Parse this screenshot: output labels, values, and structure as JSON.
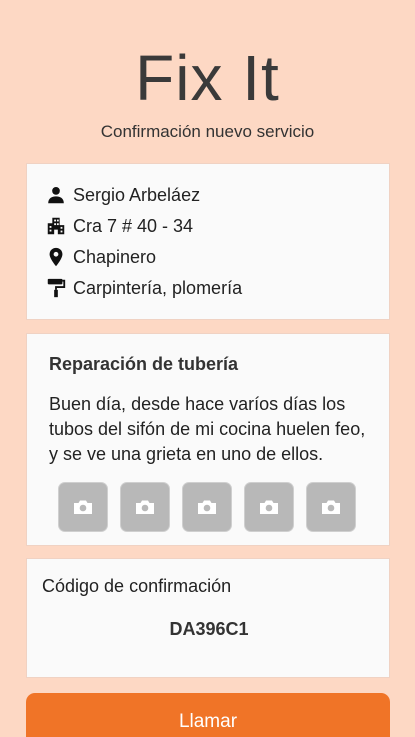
{
  "app": {
    "title": "Fix It",
    "subtitle": "Confirmación nuevo servicio"
  },
  "client": {
    "name": "Sergio Arbeláez",
    "address": "Cra 7 # 40 - 34",
    "neighborhood": "Chapinero",
    "services": "Carpintería, plomería",
    "icons": [
      "person-icon",
      "building-icon",
      "location-pin-icon",
      "paint-roller-icon"
    ]
  },
  "job": {
    "title": "Reparación de tubería",
    "description": "Buen día, desde hace varíos días los tubos del sifón de mi cocina huelen feo, y se ve una grieta en uno de ellos.",
    "photos": [
      "camera-icon",
      "camera-icon",
      "camera-icon",
      "camera-icon",
      "camera-icon"
    ]
  },
  "confirmation": {
    "label": "Código de confirmación",
    "code": "DA396C1"
  },
  "actions": {
    "call_label": "Llamar"
  },
  "colors": {
    "background": "#fdd8c4",
    "card": "#fafafa",
    "accent": "#f07427",
    "photo_placeholder": "#b8b8b8"
  }
}
